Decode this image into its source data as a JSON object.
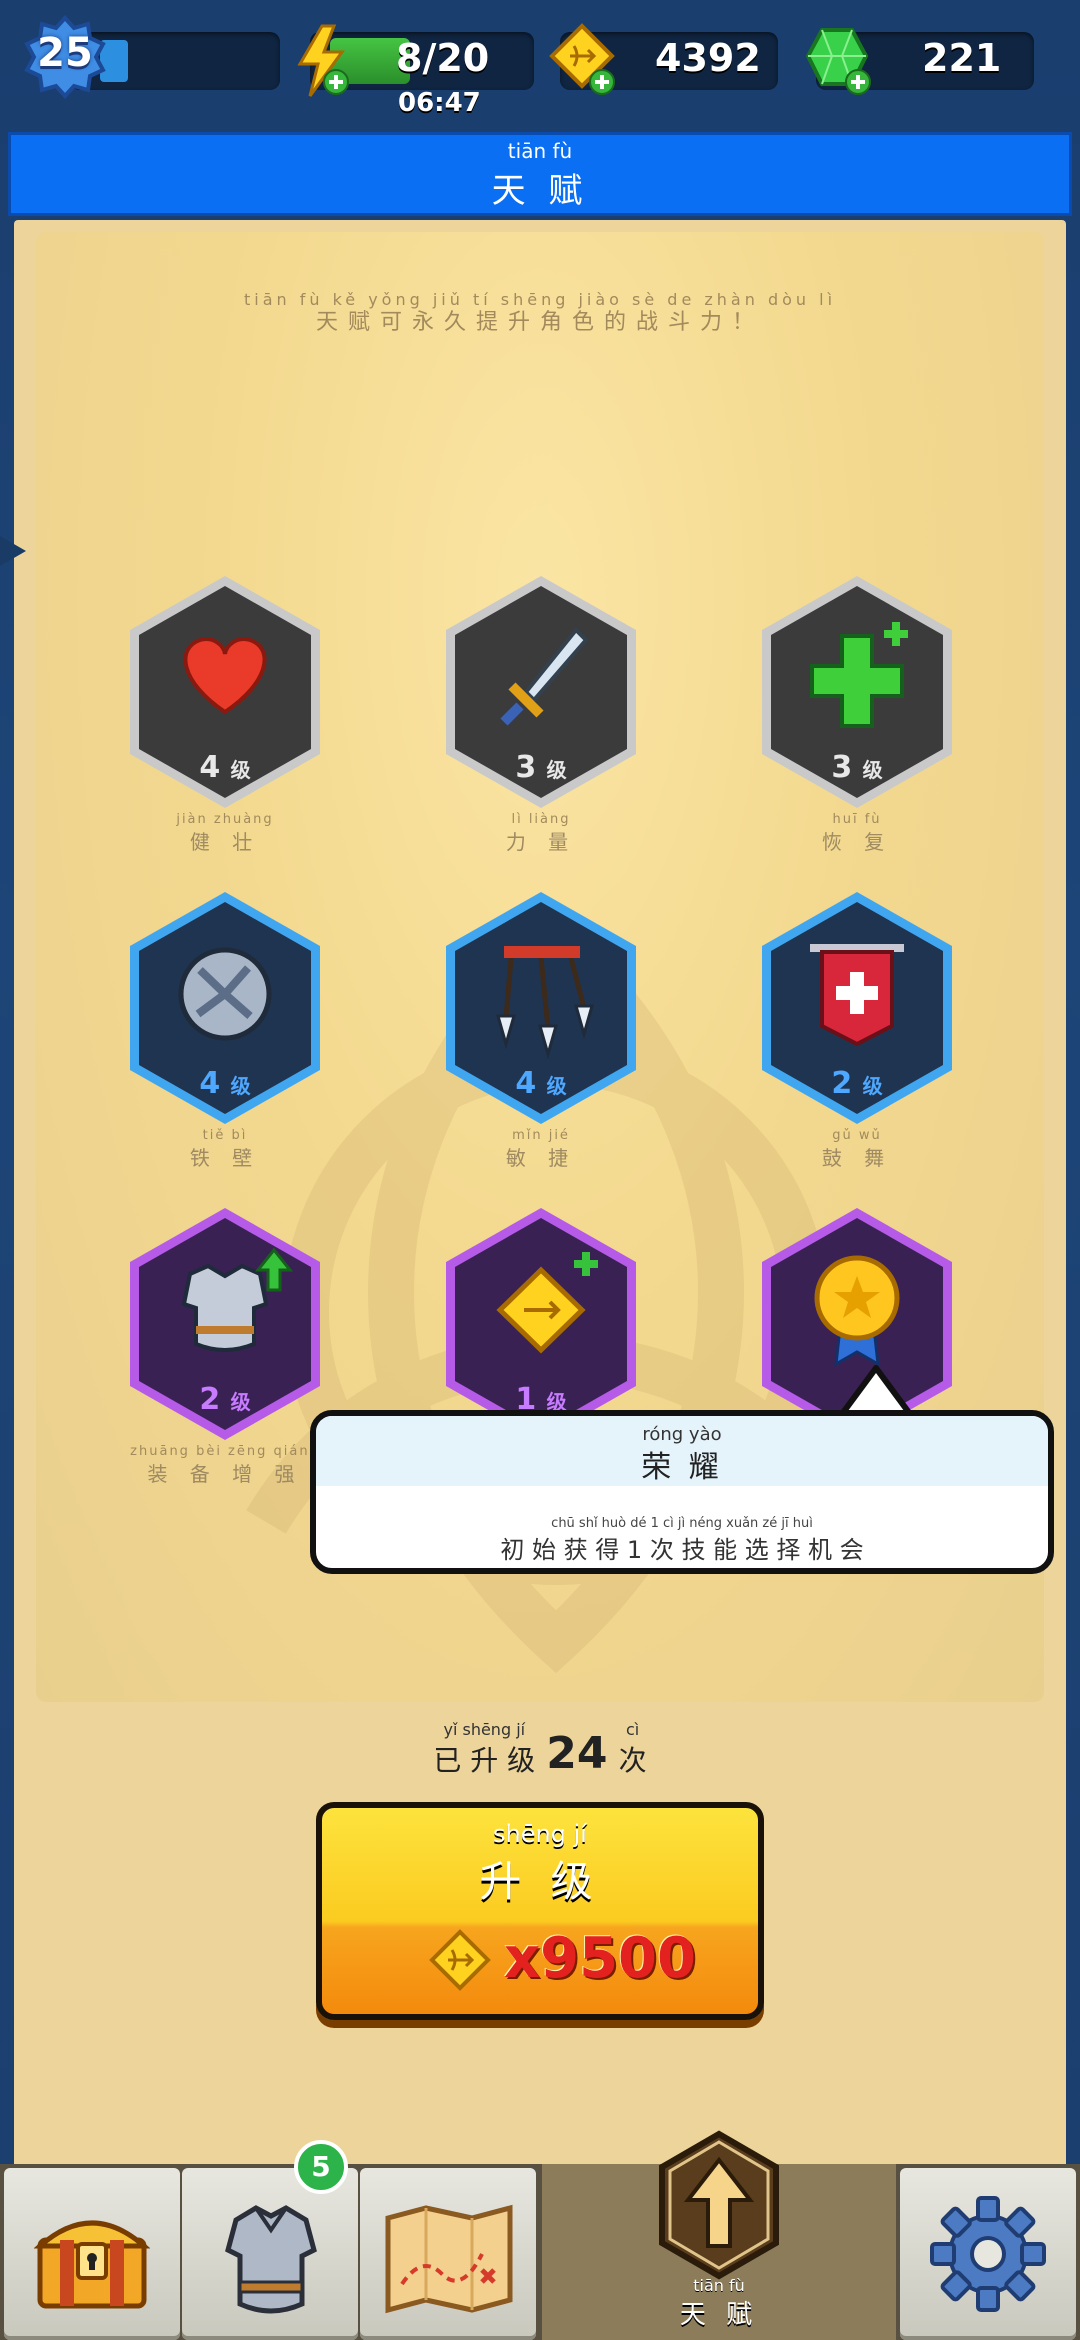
{
  "topbar": {
    "level": "25",
    "energy": "8/20",
    "timer": "06:47",
    "gold": "4392",
    "gems": "221"
  },
  "title": {
    "pinyin": "tiān fù",
    "text": "天 赋"
  },
  "hint": {
    "pinyin": "tiān fù  kě  yǒng  jiǔ  tí  shēng jiào  sè  de  zhàn dòu  lì",
    "text": "天赋可永久提升角色的战斗力！"
  },
  "talents": [
    {
      "icon": "heart-icon",
      "level": "4",
      "level_suffix": "级",
      "name": "健 壮",
      "pinyin": "jiàn zhuàng",
      "tier": "gray"
    },
    {
      "icon": "sword-icon",
      "level": "3",
      "level_suffix": "级",
      "name": "力 量",
      "pinyin": "lì  liàng",
      "tier": "gray"
    },
    {
      "icon": "green-cross-icon",
      "level": "3",
      "level_suffix": "级",
      "name": "恢 复",
      "pinyin": "huī  fù",
      "tier": "gray"
    },
    {
      "icon": "spiked-shield-icon",
      "level": "4",
      "level_suffix": "级",
      "name": "铁 壁",
      "pinyin": "tiě  bì",
      "tier": "blue"
    },
    {
      "icon": "arrows-icon",
      "level": "4",
      "level_suffix": "级",
      "name": "敏 捷",
      "pinyin": "mǐn  jié",
      "tier": "blue"
    },
    {
      "icon": "red-banner-icon",
      "level": "2",
      "level_suffix": "级",
      "name": "鼓 舞",
      "pinyin": "gǔ  wǔ",
      "tier": "blue"
    },
    {
      "icon": "armor-upgrade-icon",
      "level": "2",
      "level_suffix": "级",
      "name": "装 备 增 强",
      "pinyin": "zhuāng bèi zēng qiáng",
      "tier": "purple"
    },
    {
      "icon": "gold-token-icon",
      "level": "1",
      "level_suffix": "级",
      "name": "",
      "pinyin": "",
      "tier": "purple"
    },
    {
      "icon": "medal-icon",
      "level": "",
      "level_suffix": "",
      "name": "",
      "pinyin": "",
      "tier": "purple"
    }
  ],
  "tooltip": {
    "title_pinyin": "róng yào",
    "title": "荣 耀",
    "desc_pinyin": "chū shǐ huò dé  1  cì  jì néng xuǎn zé  jī  huì",
    "desc": "初 始 获 得 1 次 技 能 选 择 机 会"
  },
  "upgraded": {
    "pinyin_left": "yǐ  shēng  jí",
    "prefix": "已 升 级",
    "count": "24",
    "pinyin_right": "cì",
    "suffix": "次"
  },
  "upgrade_button": {
    "pinyin": "shēng  jí",
    "label": "升 级",
    "cost": "x9500"
  },
  "nav": {
    "items": [
      "chest-icon",
      "armor-icon",
      "map-icon",
      "talent-arrow-icon",
      "gear-icon"
    ],
    "badge": "5",
    "active_pinyin": "tiān  fù",
    "active_label": "天 赋"
  },
  "colors": {
    "gray_hex": "#3b3b3b",
    "blue_hex": "#1f3450",
    "purple_hex": "#3a2153",
    "gray_rim": "#c9c9c9",
    "blue_rim": "#41a6f0",
    "purple_rim": "#b65be8"
  }
}
